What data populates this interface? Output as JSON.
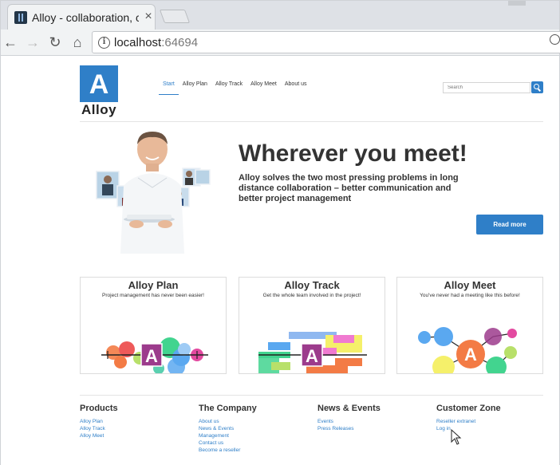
{
  "browser": {
    "tab_title": "Alloy - collaboration, com",
    "tab_close": "×",
    "url_host": "localhost",
    "url_port": ":64694",
    "back_icon": "←",
    "forward_icon": "→",
    "reload_icon": "↻",
    "home_icon": "⌂",
    "info_icon": "i"
  },
  "header": {
    "logo_letter": "A",
    "logo_text": "Alloy",
    "nav": [
      "Start",
      "Alloy Plan",
      "Alloy Track",
      "Alloy Meet",
      "About us"
    ],
    "search_placeholder": "Search"
  },
  "hero": {
    "title": "Wherever you meet!",
    "subtitle": "Alloy solves the two most pressing problems in long distance collaboration – better communication and better project management",
    "button": "Read more"
  },
  "products": [
    {
      "title": "Alloy Plan",
      "tagline": "Project management has never been easier!"
    },
    {
      "title": "Alloy Track",
      "tagline": "Get the whole team involved in the project!"
    },
    {
      "title": "Alloy Meet",
      "tagline": "You've never had a meeting like this before!"
    }
  ],
  "footer": {
    "products": {
      "title": "Products",
      "links": [
        "Alloy Plan",
        "Alloy Track",
        "Alloy Meet"
      ]
    },
    "company": {
      "title": "The Company",
      "links": [
        "About us",
        "News & Events",
        "Management",
        "Contact us",
        "Become a reseller"
      ]
    },
    "news": {
      "title": "News & Events",
      "links": [
        "Events",
        "Press Releases"
      ]
    },
    "customer": {
      "title": "Customer Zone",
      "links": [
        "Reseller extranet",
        "Log in"
      ]
    }
  },
  "colors": {
    "brand_blue": "#2f7fc8",
    "logo_A_fill": "#9c3b8c"
  }
}
